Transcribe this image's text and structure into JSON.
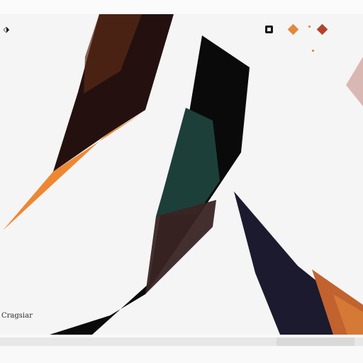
{
  "app": {
    "back_glyph": "⬗",
    "label": "Cragsiar"
  },
  "toolbar": {
    "icons": [
      {
        "name": "square-stop-icon",
        "color": "#151515"
      },
      {
        "name": "orange-diamond-icon",
        "color": "#e08a3c"
      },
      {
        "name": "red-diamond-icon",
        "color": "#b2432d"
      }
    ]
  },
  "colors": {
    "background": "#f5f5f5",
    "dark_shape": "#0c0b0b",
    "brown_shape": "#2a1512",
    "orange_accent": "#ee8732",
    "teal_accent": "#1d3f3a",
    "navy_shape": "#1b1a2e",
    "rust_accent": "#c2622e"
  }
}
